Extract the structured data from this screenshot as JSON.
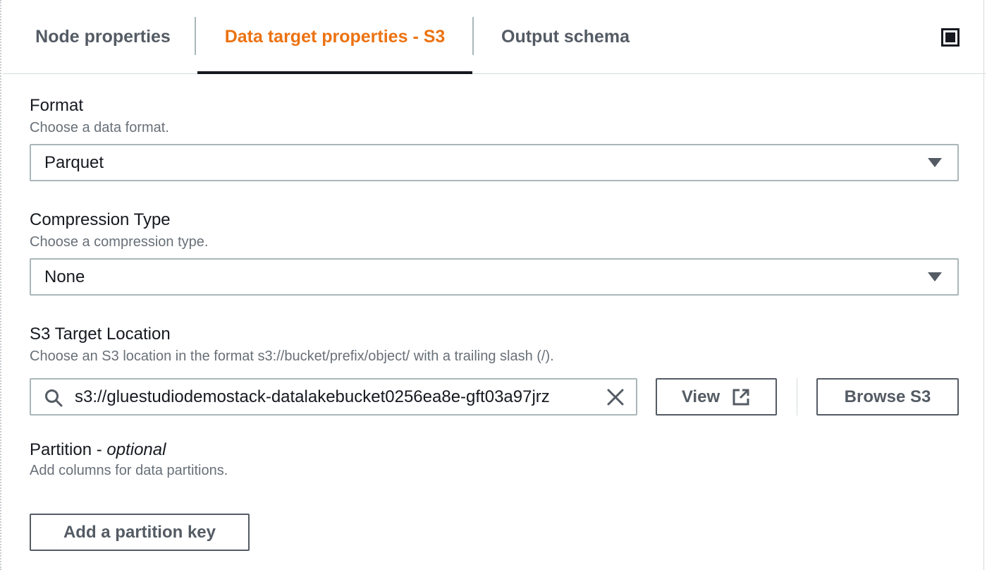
{
  "tabs": [
    {
      "label": "Node properties",
      "active": false
    },
    {
      "label": "Data target properties - S3",
      "active": true
    },
    {
      "label": "Output schema",
      "active": false
    }
  ],
  "icons": {
    "panel": "panel-toggle-icon",
    "search": "search-icon",
    "clear": "close-icon",
    "external": "external-link-icon",
    "dropdown": "caret-down-icon"
  },
  "colors": {
    "active_tab": "#ec7211",
    "text": "#16191f",
    "muted": "#687078",
    "border": "#aab7b8"
  },
  "format": {
    "label": "Format",
    "description": "Choose a data format.",
    "selected": "Parquet"
  },
  "compression": {
    "label": "Compression Type",
    "description": "Choose a compression type.",
    "selected": "None"
  },
  "s3_target": {
    "label": "S3 Target Location",
    "description": "Choose an S3 location in the format s3://bucket/prefix/object/ with a trailing slash (/).",
    "value": "s3://gluestudiodemostack-datalakebucket0256ea8e-gft03a97jrz",
    "view_label": "View",
    "browse_label": "Browse S3"
  },
  "partition": {
    "label": "Partition - ",
    "label_optional": "optional",
    "description": "Add columns for data partitions.",
    "add_key_label": "Add a partition key"
  }
}
